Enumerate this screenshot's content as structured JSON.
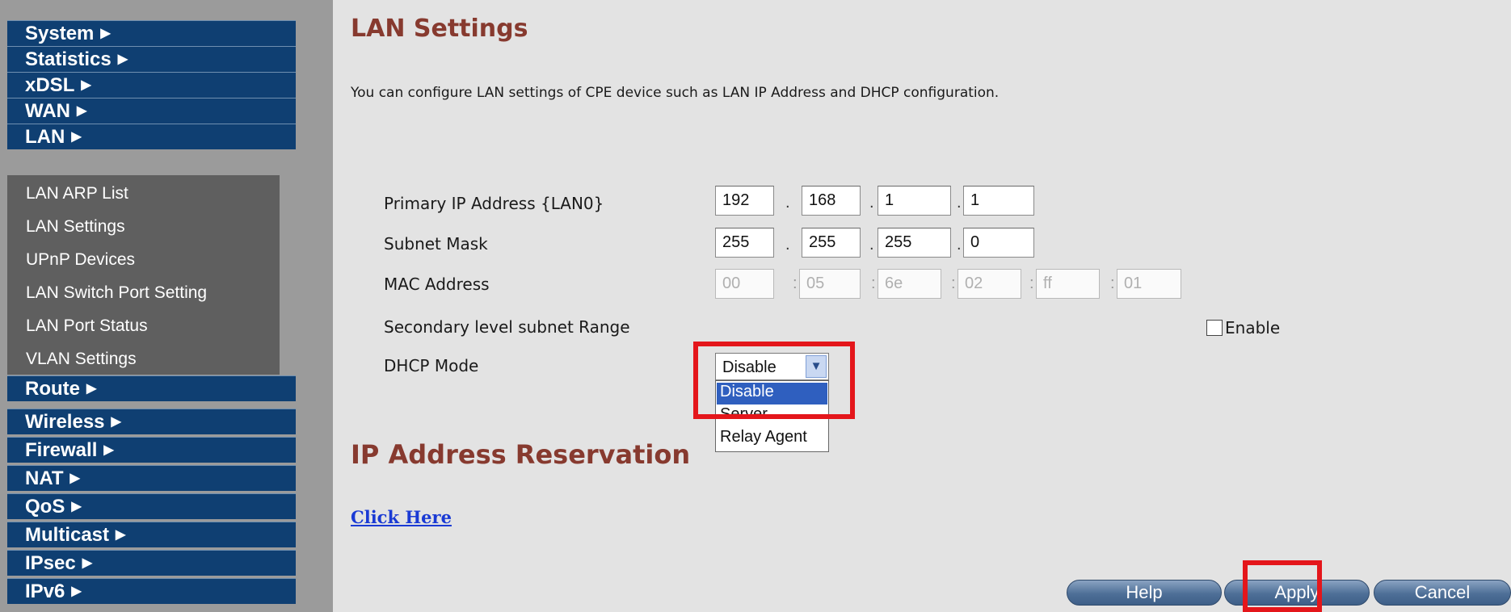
{
  "sidebar": {
    "main_items": [
      {
        "label": "System"
      },
      {
        "label": "Statistics"
      },
      {
        "label": "xDSL"
      },
      {
        "label": "WAN"
      },
      {
        "label": "LAN"
      },
      {
        "label": "Route"
      },
      {
        "label": "Wireless"
      },
      {
        "label": "Firewall"
      },
      {
        "label": "NAT"
      },
      {
        "label": "QoS"
      },
      {
        "label": "Multicast"
      },
      {
        "label": "IPsec"
      },
      {
        "label": "IPv6"
      }
    ],
    "arrow": "▶",
    "lan_sub_items": [
      {
        "label": "LAN ARP List"
      },
      {
        "label": "LAN Settings"
      },
      {
        "label": "UPnP Devices"
      },
      {
        "label": "LAN Switch Port Setting"
      },
      {
        "label": "LAN Port Status"
      },
      {
        "label": "VLAN Settings"
      }
    ]
  },
  "page": {
    "title": "LAN Settings",
    "description": "You can configure LAN settings of CPE device such as LAN IP Address and DHCP configuration."
  },
  "form": {
    "primary_ip": {
      "label": "Primary IP Address {LAN0}",
      "octets": [
        "192",
        "168",
        "1",
        "1"
      ]
    },
    "subnet_mask": {
      "label": "Subnet Mask",
      "octets": [
        "255",
        "255",
        "255",
        "0"
      ]
    },
    "mac_address": {
      "label": "MAC Address",
      "octets": [
        "00",
        "05",
        "6e",
        "02",
        "ff",
        "01"
      ]
    },
    "secondary_subnet": {
      "label": "Secondary level subnet Range",
      "enable_label": "Enable",
      "enabled": false
    },
    "dhcp_mode": {
      "label": "DHCP Mode",
      "selected": "Disable",
      "options": [
        "Disable",
        "Server",
        "Relay Agent"
      ]
    },
    "ip_separator": ".",
    "mac_separator": ":"
  },
  "reservation": {
    "title": "IP Address Reservation",
    "link": "Click Here"
  },
  "buttons": {
    "help": "Help",
    "apply": "Apply",
    "cancel": "Cancel"
  },
  "colors": {
    "nav_bg": "#0f3f72",
    "sub_nav_bg": "#5f5f5f",
    "title": "#873a2f",
    "highlight": "#e4161b",
    "link": "#1a3ad4"
  }
}
